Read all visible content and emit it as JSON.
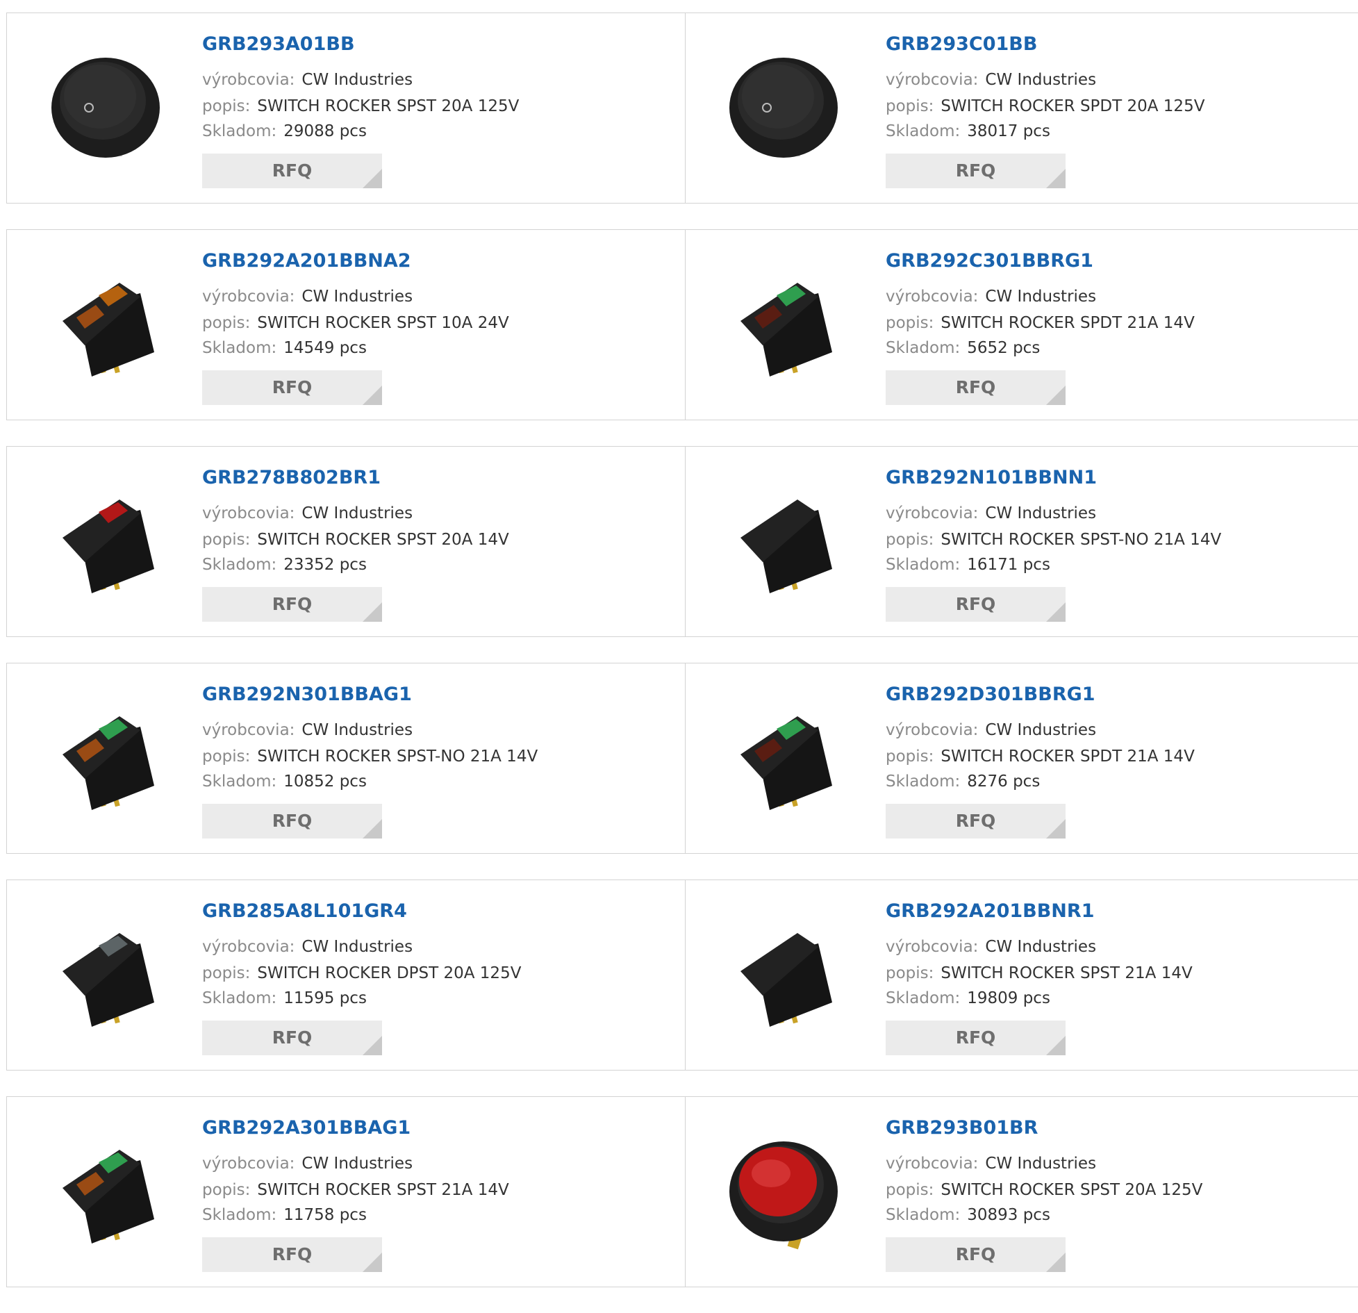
{
  "labels": {
    "manufacturer": "výrobcovia:",
    "description": "popis:",
    "stock": "Skladom:",
    "rfq": "RFQ"
  },
  "colors": {
    "part_link": "#1a63ad",
    "label": "#8a8a8a",
    "value": "#333333",
    "rfq_bg": "#ebebeb"
  },
  "products": [
    {
      "part": "GRB293A01BB",
      "manufacturer": "CW Industries",
      "description": "SWITCH ROCKER SPST 20A 125V",
      "stock": "29088 pcs",
      "image": "round-black-rocker-switch-icon"
    },
    {
      "part": "GRB293C01BB",
      "manufacturer": "CW Industries",
      "description": "SWITCH ROCKER SPDT 20A 125V",
      "stock": "38017 pcs",
      "image": "round-black-rocker-switch-icon"
    },
    {
      "part": "GRB292A201BBNA2",
      "manufacturer": "CW Industries",
      "description": "SWITCH ROCKER SPST 10A 24V",
      "stock": "14549 pcs",
      "image": "rocker-switch-amber-lens-icon"
    },
    {
      "part": "GRB292C301BBRG1",
      "manufacturer": "CW Industries",
      "description": "SWITCH ROCKER SPDT 21A 14V",
      "stock": "5652 pcs",
      "image": "rocker-switch-green-red-lens-icon"
    },
    {
      "part": "GRB278B802BR1",
      "manufacturer": "CW Industries",
      "description": "SWITCH ROCKER SPST 20A 14V",
      "stock": "23352 pcs",
      "image": "rocker-switch-red-lens-icon"
    },
    {
      "part": "GRB292N101BBNN1",
      "manufacturer": "CW Industries",
      "description": "SWITCH ROCKER SPST-NO 21A 14V",
      "stock": "16171 pcs",
      "image": "rocker-switch-black-icon"
    },
    {
      "part": "GRB292N301BBAG1",
      "manufacturer": "CW Industries",
      "description": "SWITCH ROCKER SPST-NO 21A 14V",
      "stock": "10852 pcs",
      "image": "rocker-switch-green-amber-lens-icon"
    },
    {
      "part": "GRB292D301BBRG1",
      "manufacturer": "CW Industries",
      "description": "SWITCH ROCKER SPDT 21A 14V",
      "stock": "8276 pcs",
      "image": "rocker-switch-green-red-lens-icon"
    },
    {
      "part": "GRB285A8L101GR4",
      "manufacturer": "CW Industries",
      "description": "SWITCH ROCKER DPST 20A 125V",
      "stock": "11595 pcs",
      "image": "rocker-switch-clear-lens-icon"
    },
    {
      "part": "GRB292A201BBNR1",
      "manufacturer": "CW Industries",
      "description": "SWITCH ROCKER SPST 21A 14V",
      "stock": "19809 pcs",
      "image": "rocker-switch-black-icon"
    },
    {
      "part": "GRB292A301BBAG1",
      "manufacturer": "CW Industries",
      "description": "SWITCH ROCKER SPST 21A 14V",
      "stock": "11758 pcs",
      "image": "rocker-switch-green-amber-lens-icon"
    },
    {
      "part": "GRB293B01BR",
      "manufacturer": "CW Industries",
      "description": "SWITCH ROCKER SPST 20A 125V",
      "stock": "30893 pcs",
      "image": "round-red-rocker-switch-icon"
    }
  ]
}
